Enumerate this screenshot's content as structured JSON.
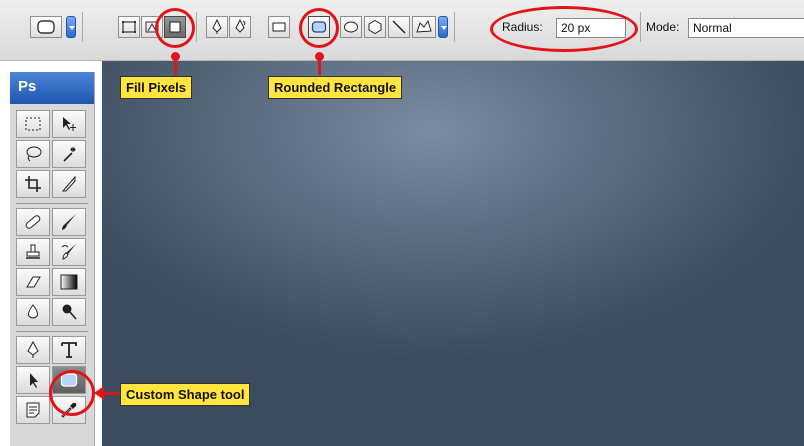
{
  "options_bar": {
    "radius_label": "Radius:",
    "radius_value": "20 px",
    "mode_label": "Mode:",
    "mode_value": "Normal",
    "buttons": [
      "shape-layers",
      "paths",
      "fill-pixels",
      "pen",
      "freeform-pen",
      "rectangle",
      "rounded-rectangle",
      "ellipse",
      "polygon",
      "line",
      "custom-shape"
    ]
  },
  "toolbox": {
    "title": "Ps"
  },
  "callouts": {
    "fill_pixels": "Fill Pixels",
    "rounded_rectangle": "Rounded Rectangle",
    "custom_shape_tool": "Custom Shape tool"
  },
  "colors": {
    "annotation": "#e1141a",
    "callout_bg": "#ffe53d",
    "canvas_center": "#7c8ca0",
    "canvas_edge": "#3c4b5e",
    "titlebar": "#2f6cc8"
  }
}
